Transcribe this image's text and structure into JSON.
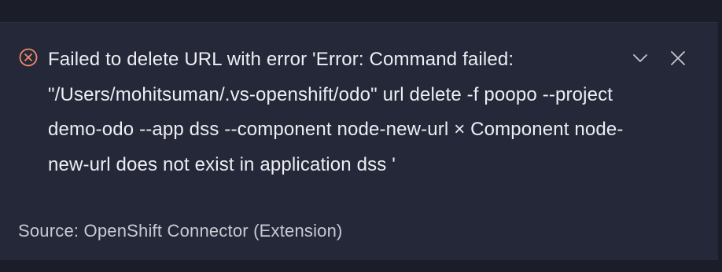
{
  "notification": {
    "severity": "error",
    "icon": "error-circle-x-icon",
    "message": "Failed to delete URL with error 'Error: Command failed: \"/Users/mohitsuman/.vs-openshift/odo\" url delete -f poopo --project demo-odo --app dss --component node-new-url × Component node-new-url does not exist in application dss '",
    "source": "Source: OpenShift Connector (Extension)",
    "actions": [
      {
        "name": "collapse",
        "icon": "chevron-down-icon"
      },
      {
        "name": "close",
        "icon": "close-icon"
      }
    ]
  },
  "colors": {
    "background": "#1b1d29",
    "panel": "#252838",
    "text": "#eceef3",
    "source_text": "#c8cad3",
    "error_icon": "#f0886c",
    "action_icon": "#c5c7d0"
  }
}
